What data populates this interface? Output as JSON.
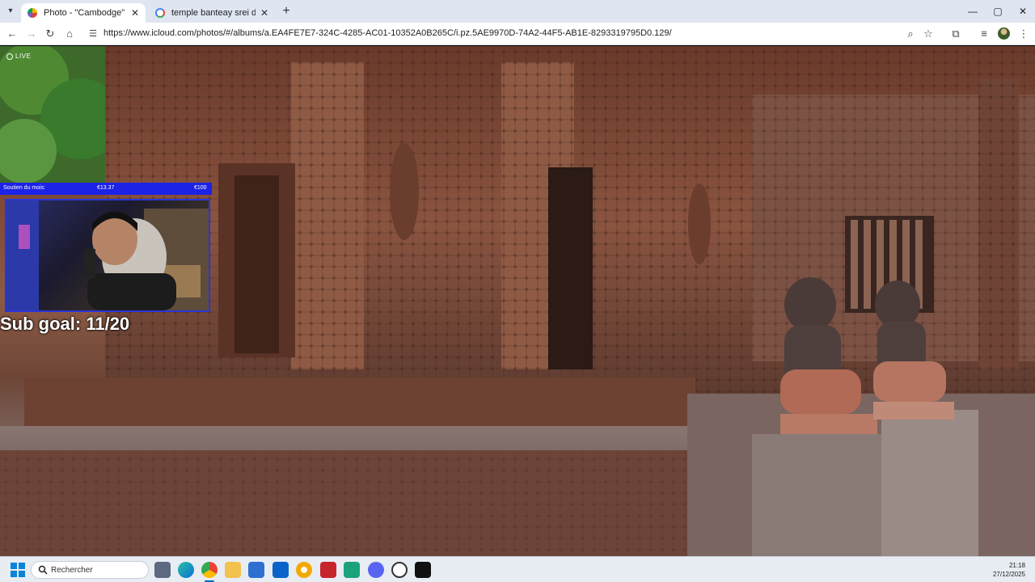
{
  "browser": {
    "tabs": [
      {
        "title": "Photo - \"Cambodge\" - iCloud Ph",
        "close": "✕",
        "active": true
      },
      {
        "title": "temple banteay srei date - Rech",
        "close": "✕",
        "active": false
      }
    ],
    "new_tab": "+",
    "window_controls": {
      "minimize": "—",
      "maximize": "▢",
      "close": "✕"
    },
    "url": "https://www.icloud.com/photos/#/albums/a.EA4FE7E7-324C-4285-AC01-10352A0B265C/i.pz.5AE9970D-74A2-44F5-AB1E-8293319795D0.129/"
  },
  "photo": {
    "live_label": "LIVE"
  },
  "overlay": {
    "sub_bar": {
      "label": "Soutien du mois:",
      "current": "€13.37",
      "target": "€100",
      "progress": 0.13
    },
    "sub_goal": "Sub goal: 11/20"
  },
  "taskbar": {
    "search_placeholder": "Rechercher",
    "time": "21:18",
    "date": "27/12/2025"
  }
}
